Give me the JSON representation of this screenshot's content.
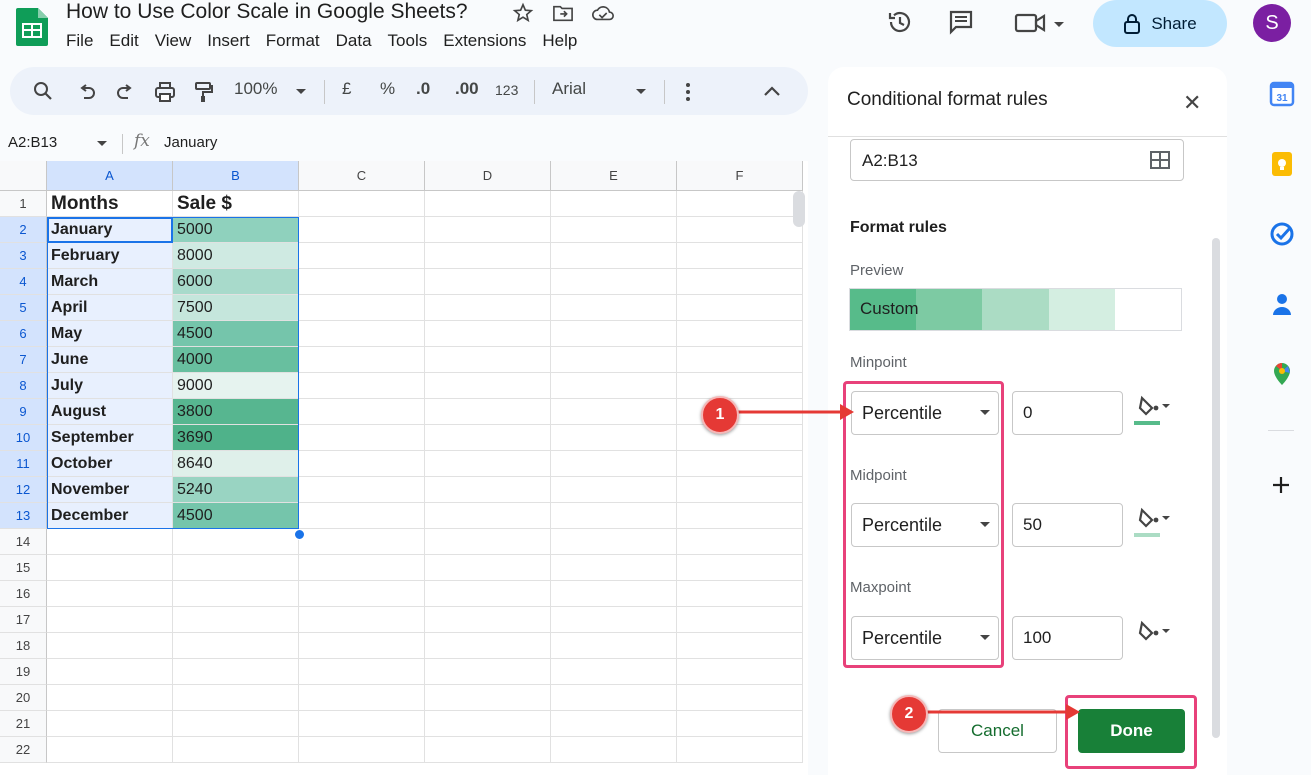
{
  "app": {
    "doc_title": "How to Use Color Scale in Google Sheets?",
    "menu": [
      "File",
      "Edit",
      "View",
      "Insert",
      "Format",
      "Data",
      "Tools",
      "Extensions",
      "Help"
    ],
    "share_label": "Share",
    "avatar_initial": "S"
  },
  "toolbar": {
    "zoom": "100%",
    "currency": "£",
    "percent": "%",
    "dec_decrease": ".0",
    "dec_increase": ".00",
    "number_format": "123",
    "font": "Arial"
  },
  "formula_bar": {
    "name_box": "A2:B13",
    "fx": "fx",
    "value": "January"
  },
  "sheet": {
    "columns": [
      "A",
      "B",
      "C",
      "D",
      "E",
      "F"
    ],
    "row_numbers": [
      "1",
      "2",
      "3",
      "4",
      "5",
      "6",
      "7",
      "8",
      "9",
      "10",
      "11",
      "12",
      "13",
      "14",
      "15",
      "16",
      "17",
      "18",
      "19",
      "20",
      "21",
      "22"
    ],
    "header": [
      "Months",
      "Sale $"
    ],
    "rows": [
      {
        "month": "January",
        "sale": "5000",
        "color": "#8fd1bd"
      },
      {
        "month": "February",
        "sale": "8000",
        "color": "#cfeae2"
      },
      {
        "month": "March",
        "sale": "6000",
        "color": "#a8dacb"
      },
      {
        "month": "April",
        "sale": "7500",
        "color": "#c5e6dc"
      },
      {
        "month": "May",
        "sale": "4500",
        "color": "#75c5ab"
      },
      {
        "month": "June",
        "sale": "4000",
        "color": "#68bf9f"
      },
      {
        "month": "July",
        "sale": "9000",
        "color": "#e6f3ef"
      },
      {
        "month": "August",
        "sale": "3800",
        "color": "#57b690"
      },
      {
        "month": "September",
        "sale": "3690",
        "color": "#4fb28a"
      },
      {
        "month": "October",
        "sale": "8640",
        "color": "#dff0ea"
      },
      {
        "month": "November",
        "sale": "5240",
        "color": "#99d4c2"
      },
      {
        "month": "December",
        "sale": "4500",
        "color": "#75c5ab"
      }
    ]
  },
  "panel": {
    "title": "Conditional format rules",
    "range": "A2:B13",
    "section": "Format rules",
    "preview_label": "Preview",
    "preview_text": "Custom",
    "preview_colors": [
      "#57bb8a",
      "#7dcaa3",
      "#abdcc4",
      "#d4eee1",
      "#ffffff"
    ],
    "minpoint": {
      "label": "Minpoint",
      "type": "Percentile",
      "value": "0",
      "color": "#57bb8a"
    },
    "midpoint": {
      "label": "Midpoint",
      "type": "Percentile",
      "value": "50",
      "color": "#abdcc4"
    },
    "maxpoint": {
      "label": "Maxpoint",
      "type": "Percentile",
      "value": "100",
      "color": "#ffffff"
    },
    "cancel": "Cancel",
    "done": "Done"
  },
  "annotations": {
    "badge1": "1",
    "badge2": "2",
    "color": "#e53935"
  }
}
